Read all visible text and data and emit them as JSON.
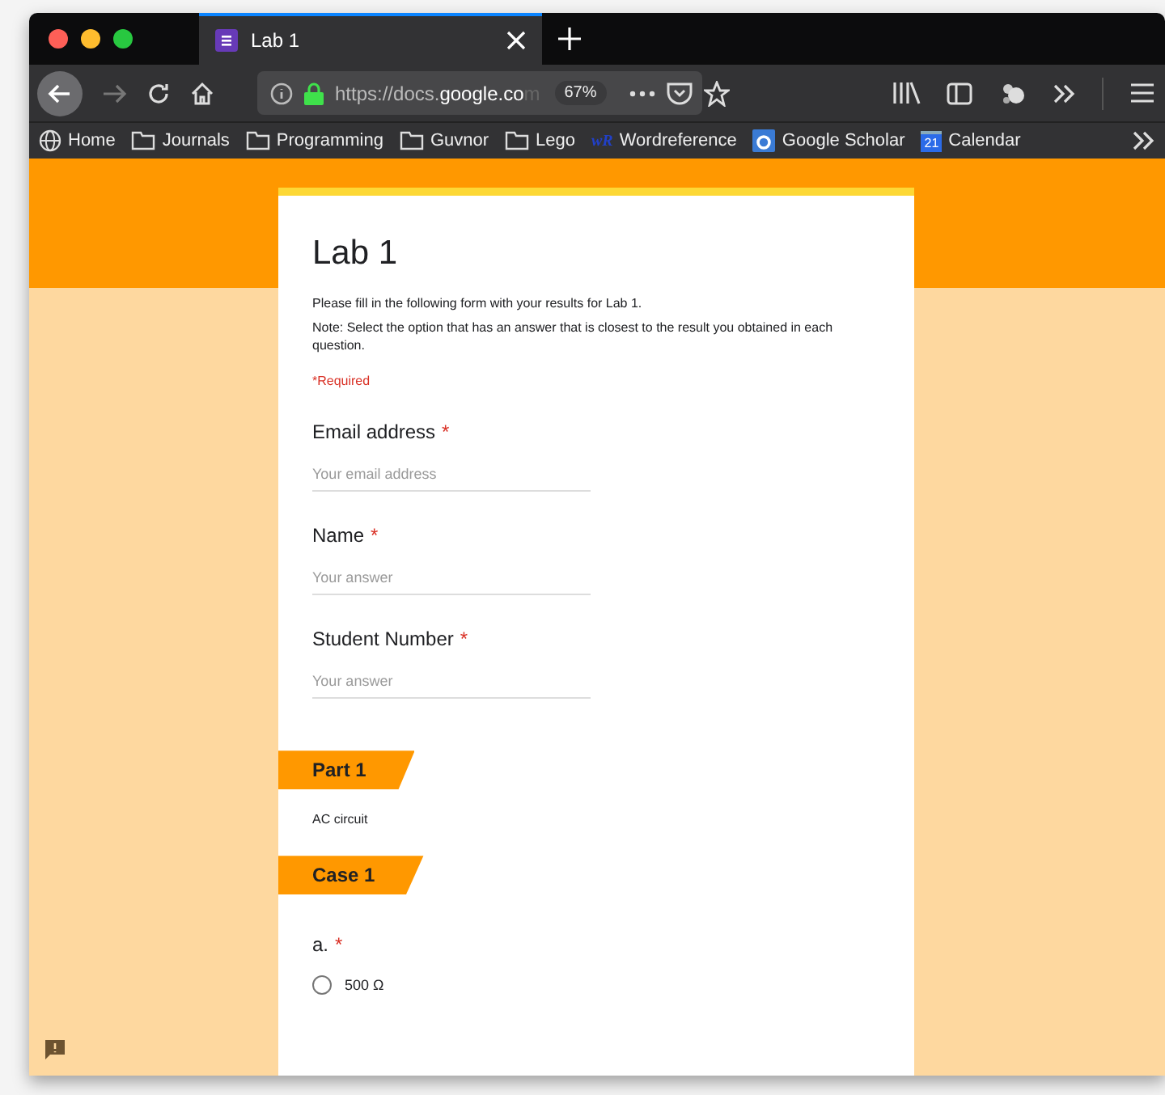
{
  "browser": {
    "tab": {
      "title": "Lab 1",
      "selected": true
    },
    "url": {
      "scheme": "https://docs.",
      "domain": "google.co",
      "rest": "m"
    },
    "zoom": "67%",
    "bookmarks": [
      {
        "kind": "globe",
        "label": "Home"
      },
      {
        "kind": "folder",
        "label": "Journals"
      },
      {
        "kind": "folder",
        "label": "Programming"
      },
      {
        "kind": "folder",
        "label": "Guvnor"
      },
      {
        "kind": "folder",
        "label": "Lego"
      },
      {
        "kind": "wr",
        "label": "Wordreference",
        "badge": "wR"
      },
      {
        "kind": "scholar",
        "label": "Google Scholar"
      },
      {
        "kind": "calendar",
        "label": "Calendar",
        "badge": "21"
      }
    ]
  },
  "form": {
    "title": "Lab 1",
    "description": "Please fill in the following form with your results for Lab 1.",
    "note": "Note: Select the option that has an answer that is closest to the result you obtained in each question.",
    "required_note": "*Required",
    "questions": [
      {
        "label": "Email address",
        "required_mark": "*",
        "placeholder": "Your email address"
      },
      {
        "label": "Name",
        "required_mark": "*",
        "placeholder": "Your answer"
      },
      {
        "label": "Student Number",
        "required_mark": "*",
        "placeholder": "Your answer"
      }
    ],
    "sections": [
      {
        "title": "Part 1",
        "description": "AC circuit"
      },
      {
        "title": "Case 1"
      }
    ],
    "choice_question": {
      "label": "a.",
      "required_mark": "*",
      "options": [
        {
          "label": "500 Ω",
          "selected": false
        }
      ]
    }
  }
}
